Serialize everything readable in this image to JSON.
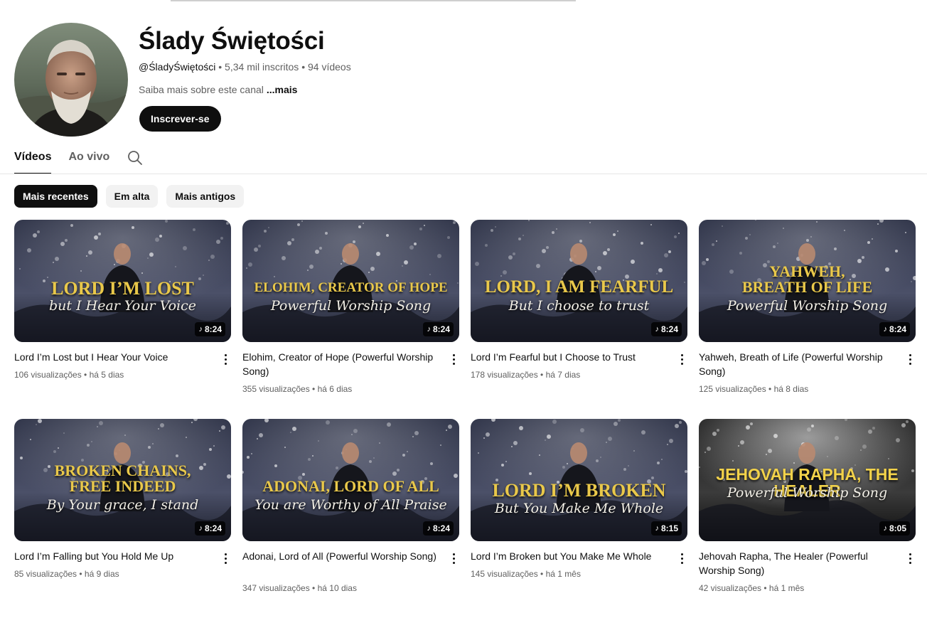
{
  "channel": {
    "name": "Ślady Świętości",
    "handle": "@ŚladyŚwiętości",
    "meta_rest": " • 5,34 mil inscritos • 94 vídeos",
    "description": "Saiba mais sobre este canal",
    "more_label": "...mais",
    "subscribe_label": "Inscrever-se"
  },
  "tabs": [
    {
      "label": "Vídeos",
      "active": true
    },
    {
      "label": "Ao vivo",
      "active": false
    }
  ],
  "search_icon": "search-icon",
  "chips": [
    {
      "label": "Mais recentes",
      "active": true
    },
    {
      "label": "Em alta",
      "active": false
    },
    {
      "label": "Mais antigos",
      "active": false
    }
  ],
  "videos": [
    {
      "title": "Lord I’m Lost but I Hear Your Voice",
      "views": "106 visualizações",
      "age": "há 5 dias",
      "duration": "8:24",
      "thumb_main": "LORD I’M LOST",
      "thumb_sub": "but I Hear Your Voice"
    },
    {
      "title": "Elohim, Creator of Hope (Powerful Worship Song)",
      "views": "355 visualizações",
      "age": "há 6 dias",
      "duration": "8:24",
      "thumb_main": "ELOHIM, CREATOR OF HOPE",
      "thumb_sub": "Powerful Worship Song"
    },
    {
      "title": "Lord I’m Fearful but I Choose to Trust",
      "views": "178 visualizações",
      "age": "há 7 dias",
      "duration": "8:24",
      "thumb_main": "LORD, I AM FEARFUL",
      "thumb_sub": "But I choose to trust"
    },
    {
      "title": "Yahweh, Breath of Life (Powerful Worship Song)",
      "views": "125 visualizações",
      "age": "há 8 dias",
      "duration": "8:24",
      "thumb_main": "YAHWEH,\nBREATH OF LIFE",
      "thumb_sub": "Powerful Worship Song"
    },
    {
      "title": "Lord I’m Falling but You Hold Me Up",
      "views": "85 visualizações",
      "age": "há 9 dias",
      "duration": "8:24",
      "thumb_main": "BROKEN CHAINS,\nFREE INDEED",
      "thumb_sub": "By Your grace, I stand"
    },
    {
      "title": "Adonai, Lord of All (Powerful Worship Song)",
      "views": "347 visualizações",
      "age": "há 10 dias",
      "duration": "8:24",
      "thumb_main": "ADONAI, LORD OF ALL",
      "thumb_sub": "You are Worthy of All Praise"
    },
    {
      "title": "Lord I’m Broken but You Make Me Whole",
      "views": "145 visualizações",
      "age": "há 1 mês",
      "duration": "8:15",
      "thumb_main": "LORD I’M BROKEN",
      "thumb_sub": "But You Make Me Whole"
    },
    {
      "title": "Jehovah Rapha, The Healer (Powerful Worship Song)",
      "views": "42 visualizações",
      "age": "há 1 mês",
      "duration": "8:05",
      "thumb_main": "JEHOVAH RAPHA, THE HEALER",
      "thumb_sub": "Powerful Worship Song"
    }
  ],
  "colors": {
    "thumb_gold": "#e9c84a",
    "thumb_bg_dark": "#2a2f44",
    "text_secondary": "#606060"
  }
}
